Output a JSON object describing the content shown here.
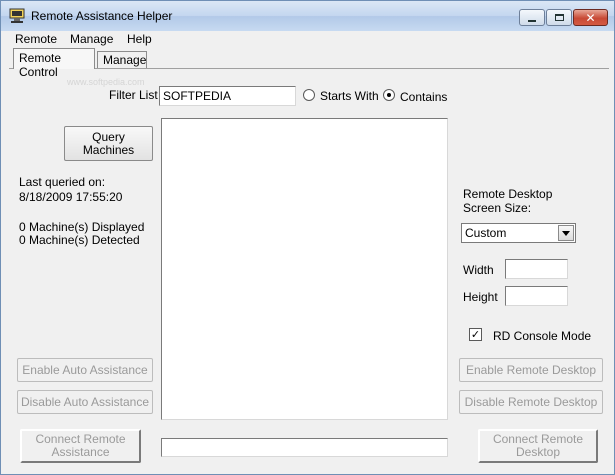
{
  "window": {
    "title": "Remote Assistance Helper"
  },
  "menu": [
    {
      "label": "Remote"
    },
    {
      "label": "Manage"
    },
    {
      "label": "Help"
    }
  ],
  "tabs": [
    {
      "label": "Remote Control",
      "active": true
    },
    {
      "label": "Manage",
      "active": false
    }
  ],
  "watermark": "www.softpedia.com",
  "filter": {
    "label": "Filter List",
    "value": "SOFTPEDIA",
    "options": [
      {
        "label": "Starts With",
        "selected": false
      },
      {
        "label": "Contains",
        "selected": true
      }
    ]
  },
  "left": {
    "query_button": "Query Machines",
    "last_queried_label": "Last queried on:",
    "last_queried_value": "8/18/2009 17:55:20",
    "displayed": "0 Machine(s) Displayed",
    "detected": "0 Machine(s) Detected",
    "enable_auto": "Enable Auto Assistance",
    "disable_auto": "Disable Auto Assistance",
    "connect_ra": "Connect Remote Assistance"
  },
  "right": {
    "screen_size_label": "Remote Desktop Screen Size:",
    "screen_size_value": "Custom",
    "width_label": "Width",
    "width_value": "",
    "height_label": "Height",
    "height_value": "",
    "console_label": "RD Console Mode",
    "console_checked": true,
    "enable_rd": "Enable Remote Desktop",
    "disable_rd": "Disable Remote Desktop",
    "connect_rd": "Connect Remote Desktop"
  },
  "status": {
    "value": ""
  },
  "colors": {
    "disabled_text": "#9a9a9a",
    "titlebar": "#c3d6ef",
    "close_button": "#c84a36"
  }
}
